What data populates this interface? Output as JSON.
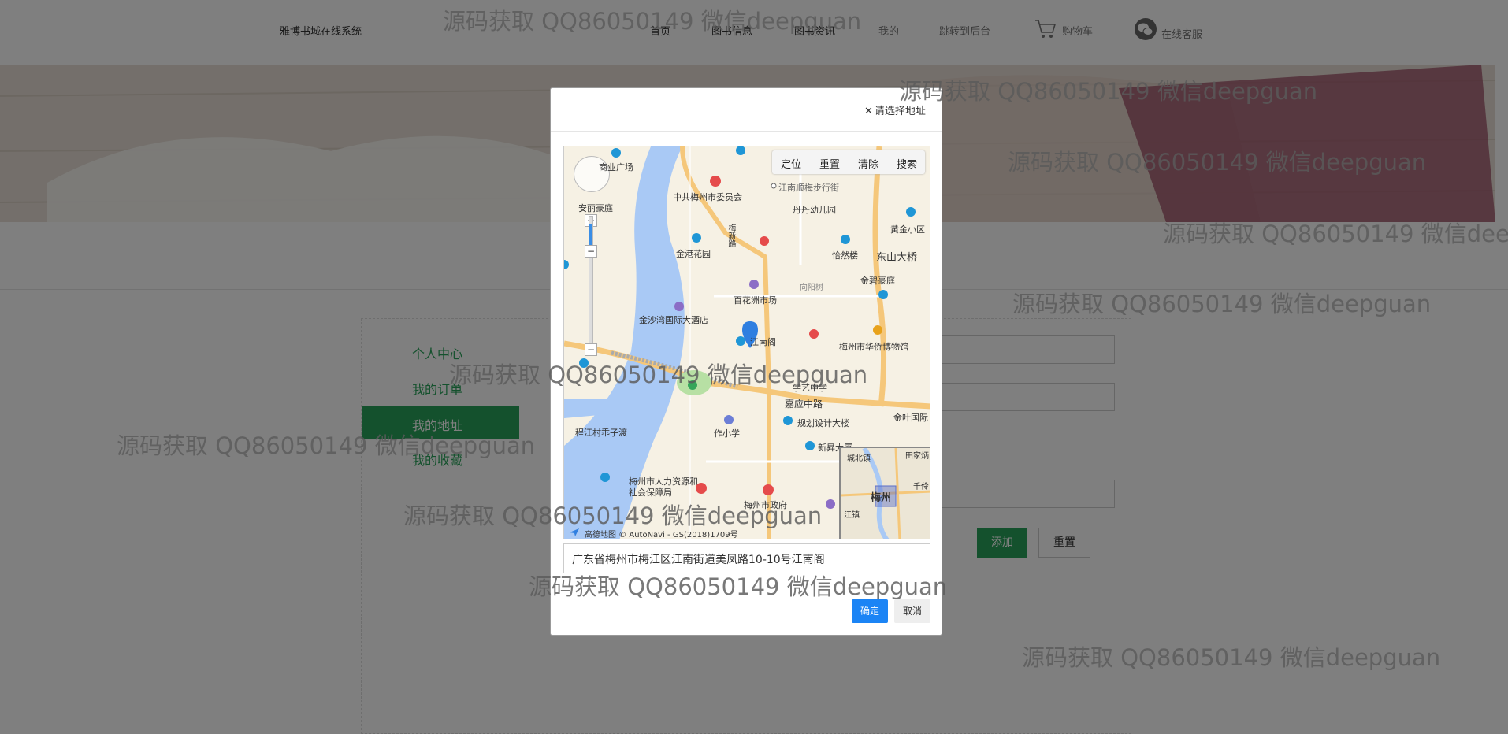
{
  "header": {
    "brand": "雅博书城在线系统",
    "nav": [
      "首页",
      "图书信息",
      "图书资讯",
      "我的",
      "跳转到后台"
    ],
    "cart_label": "购物车",
    "service_label": "在线客服"
  },
  "sidebar": {
    "items": [
      {
        "label": "个人中心"
      },
      {
        "label": "我的订单"
      },
      {
        "label": "我的地址"
      },
      {
        "label": "我的收藏"
      }
    ]
  },
  "form": {
    "add_label": "添加",
    "reset_label": "重置"
  },
  "modal": {
    "title": "请选择地址",
    "toolbar": [
      "定位",
      "重置",
      "清除",
      "搜索"
    ],
    "address_value": "广东省梅州市梅江区江南街道美凤路10-10号江南阁",
    "confirm_label": "确定",
    "cancel_label": "取消"
  },
  "map": {
    "labels": [
      "商业广场",
      "中共梅州市委员会",
      "江南顺梅步行街",
      "丹丹幼儿园",
      "黄金小区",
      "安丽豪庭",
      "金港花园",
      "梅新路",
      "怡然楼",
      "东山大桥",
      "金碧豪庭",
      "百花洲市场",
      "向阳树",
      "金沙湾国际大酒店",
      "江南阁",
      "梅州市华侨博物馆",
      "学艺中学",
      "嘉应中路",
      "规划设计大楼",
      "金叶国际",
      "程江村乖子渡",
      "作小学",
      "新昇大厦",
      "梅州市人力资源和社会保障局",
      "梅州市政府",
      "城北镇",
      "田家炳",
      "梅州",
      "江镇",
      "千伶"
    ],
    "footer": "高德地图 © AutoNavi - GS(2018)1709号"
  },
  "watermark": "源码获取 QQ86050149 微信deepguan"
}
